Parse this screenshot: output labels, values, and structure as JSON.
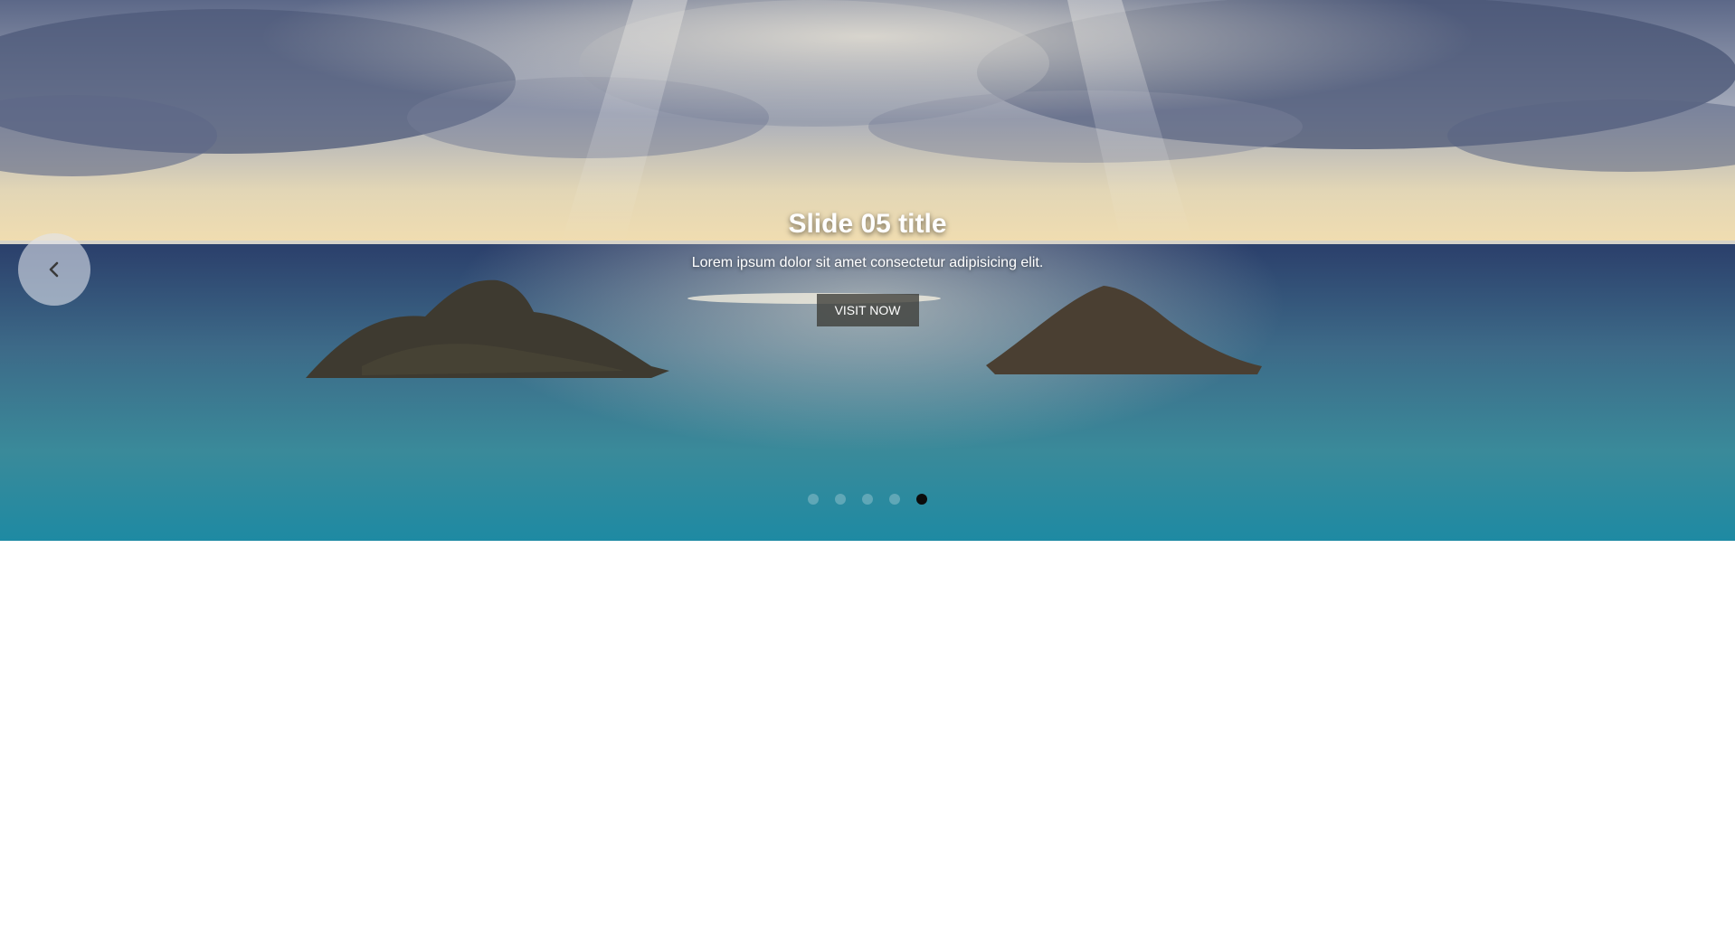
{
  "slider": {
    "title": "Slide 05 title",
    "text": "Lorem ipsum dolor sit amet consectetur adipisicing elit.",
    "button_label": "VISIT NOW",
    "prev_icon": "chevron-left-icon",
    "active_slide": 5,
    "dots": [
      "1",
      "2",
      "3",
      "4",
      "5"
    ]
  },
  "colors": {
    "sky_dark": "#4a5575",
    "sea": "#1f6e8e",
    "button_bg": "#3c3c37",
    "active_dot": "#0c0c0c"
  }
}
